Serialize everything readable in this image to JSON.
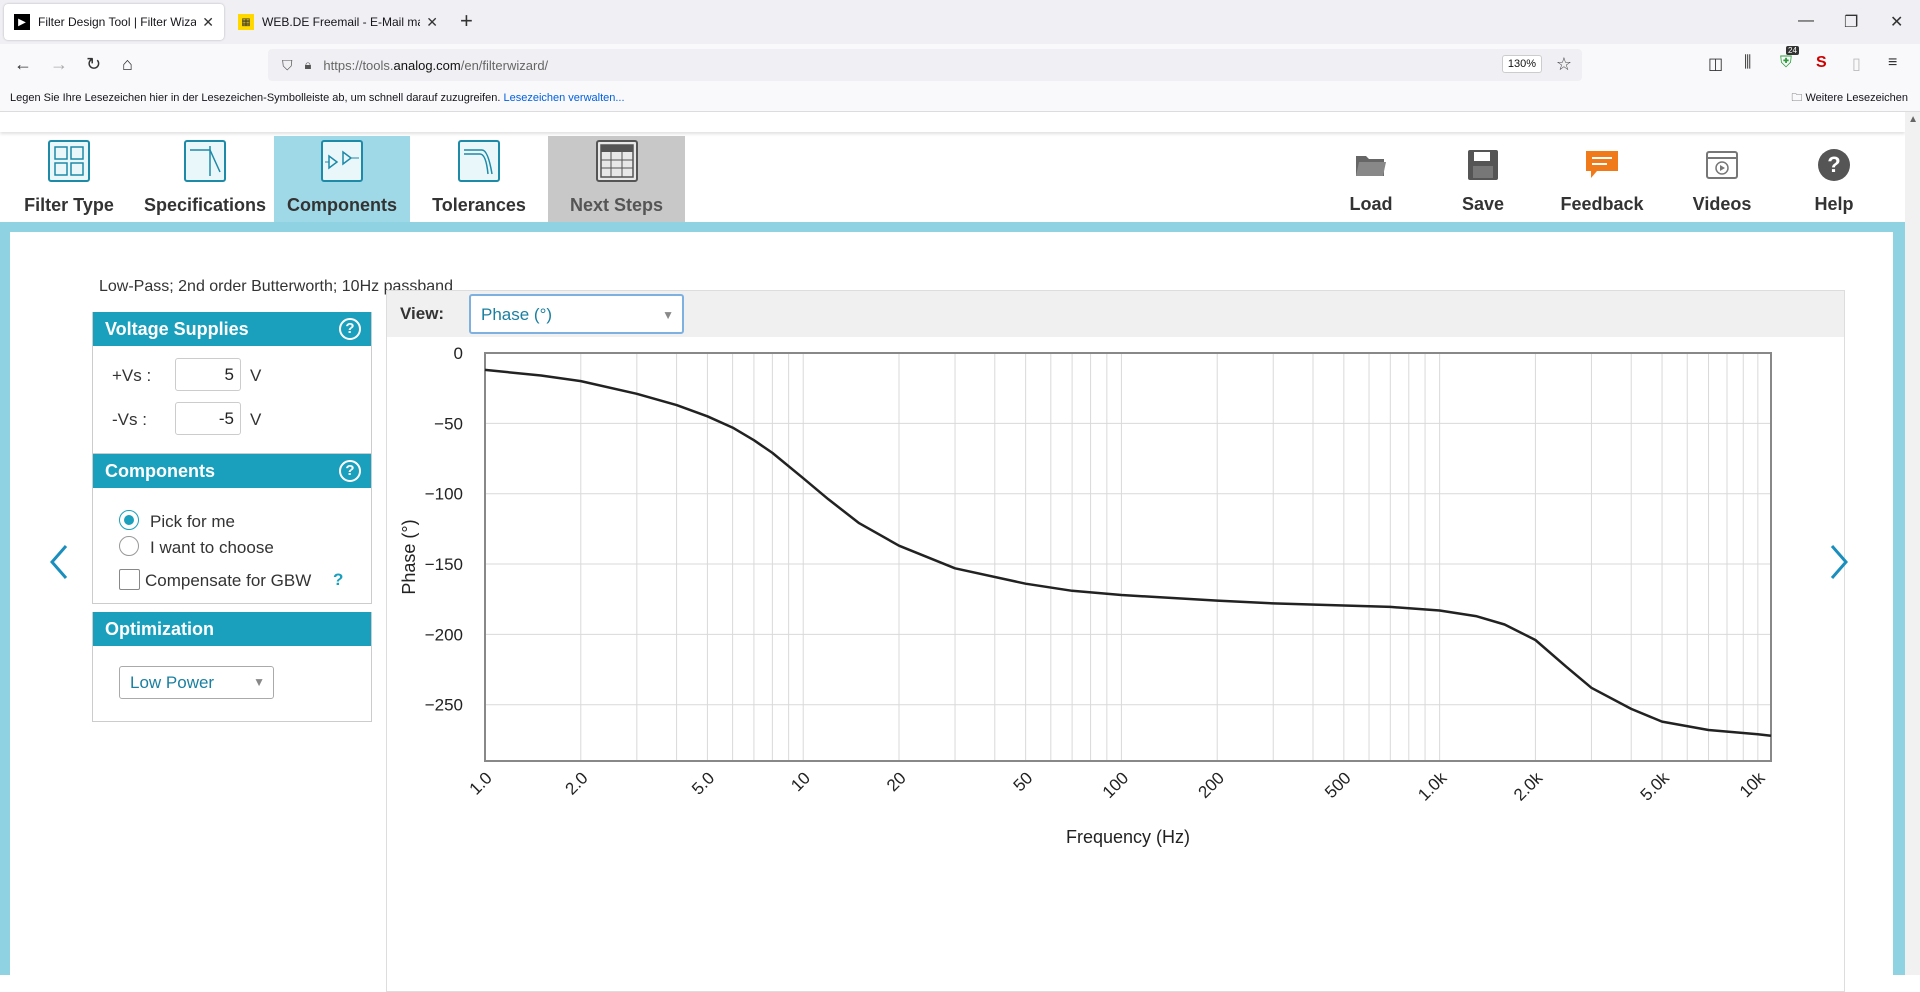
{
  "browser": {
    "tabs": [
      {
        "title": "Filter Design Tool | Filter Wizard",
        "active": true
      },
      {
        "title": "WEB.DE Freemail - E-Mail made",
        "active": false
      }
    ],
    "url_prefix": "https://tools.",
    "url_domain": "analog.com",
    "url_path": "/en/filterwizard/",
    "zoom": "130%",
    "toolbar_badge": "24",
    "bookmarks_text": "Legen Sie Ihre Lesezeichen hier in der Lesezeichen-Symbolleiste ab, um schnell darauf zuzugreifen.",
    "bookmarks_link": "Lesezeichen verwalten...",
    "bookmarks_more": "Weitere Lesezeichen"
  },
  "steps": [
    {
      "label": "Filter Type",
      "state": "normal"
    },
    {
      "label": "Specifications",
      "state": "normal"
    },
    {
      "label": "Components",
      "state": "active"
    },
    {
      "label": "Tolerances",
      "state": "normal"
    },
    {
      "label": "Next Steps",
      "state": "gray"
    }
  ],
  "tools": [
    {
      "label": "Load",
      "icon": "folder-icon"
    },
    {
      "label": "Save",
      "icon": "floppy-disk-icon"
    },
    {
      "label": "Feedback",
      "icon": "speech-bubble-icon"
    },
    {
      "label": "Videos",
      "icon": "video-icon"
    },
    {
      "label": "Help",
      "icon": "help-icon"
    }
  ],
  "subtitle": "Low-Pass; 2nd order Butterworth; 10Hz passband",
  "voltage": {
    "title": "Voltage Supplies",
    "help": "?",
    "plus_label": "+Vs :",
    "plus_value": "5",
    "minus_label": "-Vs :",
    "minus_value": "-5",
    "unit": "V"
  },
  "components": {
    "title": "Components",
    "help": "?",
    "option1": "Pick for me",
    "option2": "I want to choose",
    "compensate": "Compensate for GBW",
    "compensate_help": "?",
    "selected": "option1"
  },
  "optimization": {
    "title": "Optimization",
    "value": "Low Power",
    "arrow": "▼"
  },
  "view": {
    "label": "View:",
    "value": "Phase (°)",
    "arrow": "▼"
  },
  "chart_data": {
    "type": "line",
    "xscale": "log",
    "xlabel": "Frequency (Hz)",
    "ylabel": "Phase (°)",
    "xlim": [
      1,
      11000
    ],
    "ylim": [
      -290,
      0
    ],
    "xticks": [
      1,
      2,
      5,
      10,
      20,
      50,
      100,
      200,
      500,
      1000,
      2000,
      5000,
      10000
    ],
    "xtick_labels": [
      "1.0",
      "2.0",
      "5.0",
      "10",
      "20",
      "50",
      "100",
      "200",
      "500",
      "1.0k",
      "2.0k",
      "5.0k",
      "10k"
    ],
    "yticks": [
      0,
      -50,
      -100,
      -150,
      -200,
      -250
    ],
    "ytick_labels": [
      "0",
      "−50",
      "−100",
      "−150",
      "−200",
      "−250"
    ],
    "grid": true,
    "series": [
      {
        "color": "#222222",
        "x": [
          1,
          1.5,
          2,
          3,
          4,
          5,
          6,
          7,
          8,
          10,
          12,
          15,
          20,
          30,
          50,
          70,
          100,
          200,
          300,
          500,
          700,
          1000,
          1300,
          1600,
          2000,
          2500,
          3000,
          4000,
          5000,
          7000,
          10000,
          11000
        ],
        "y": [
          -12,
          -16,
          -20,
          -29,
          -37,
          -45,
          -53,
          -62,
          -71,
          -89,
          -104,
          -121,
          -137,
          -153,
          -164,
          -169,
          -172,
          -176,
          -178,
          -179.5,
          -180.5,
          -183,
          -187,
          -193,
          -204,
          -223,
          -238,
          -253,
          -262,
          -268,
          -271,
          -272
        ]
      }
    ]
  }
}
